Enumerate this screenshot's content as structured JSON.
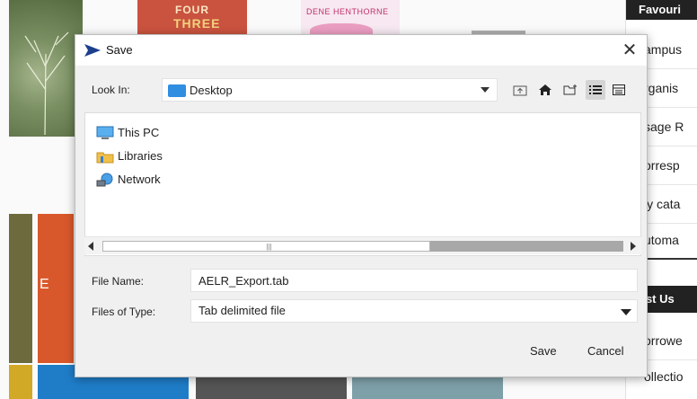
{
  "background": {
    "book_covers": [
      {
        "name": "tree-cover"
      },
      {
        "name": "red-cover",
        "lines": [
          "FOUR",
          "THREE"
        ]
      },
      {
        "name": "pink-cover",
        "lines": [
          "DENE HENTHORNE"
        ]
      }
    ],
    "sidebar": {
      "section1_title": "Favouri",
      "items": [
        "ampus",
        "rganis",
        "sage R",
        "orresp",
        "ly cata",
        "utoma"
      ],
      "section2_title": "ost Us",
      "items2": [
        "orrowe",
        "ollectio"
      ]
    },
    "tile_letter": "E"
  },
  "dialog": {
    "title": "Save",
    "close_glyph": "✕",
    "look_in": {
      "label": "Look In:",
      "value": "Desktop"
    },
    "toolbar": {
      "up_icon": "up-folder-icon",
      "home_icon": "home-icon",
      "new_folder_icon": "new-folder-icon",
      "list_icon": "list-view-icon",
      "details_icon": "details-view-icon"
    },
    "files": [
      {
        "label": "This PC",
        "icon": "computer-icon"
      },
      {
        "label": "Libraries",
        "icon": "libraries-icon"
      },
      {
        "label": "Network",
        "icon": "network-icon"
      }
    ],
    "scroll": {
      "position": 0,
      "visible_fraction": 0.63
    },
    "file_name": {
      "label": "File Name:",
      "value": "AELR_Export.tab"
    },
    "file_type": {
      "label": "Files of Type:",
      "value": "Tab delimited file"
    },
    "buttons": {
      "save": "Save",
      "cancel": "Cancel"
    }
  }
}
